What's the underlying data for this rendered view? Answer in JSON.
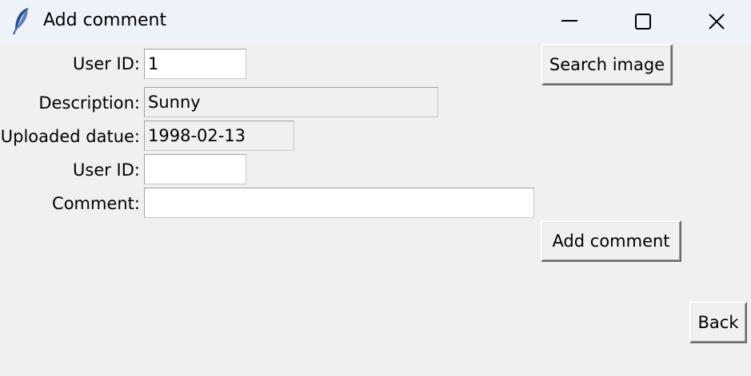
{
  "window": {
    "title": "Add comment",
    "icon": "feather-icon"
  },
  "form": {
    "user_id_label": "User ID:",
    "user_id_value": "1",
    "search_button": "Search image",
    "description_label": "Description:",
    "description_value": "Sunny",
    "uploaded_label": "Uploaded datue:",
    "uploaded_value": "1998-02-13",
    "comment_user_id_label": "User ID:",
    "comment_user_id_value": "",
    "comment_label": "Comment:",
    "comment_value": "",
    "add_comment_button": "Add comment",
    "back_button": "Back"
  }
}
